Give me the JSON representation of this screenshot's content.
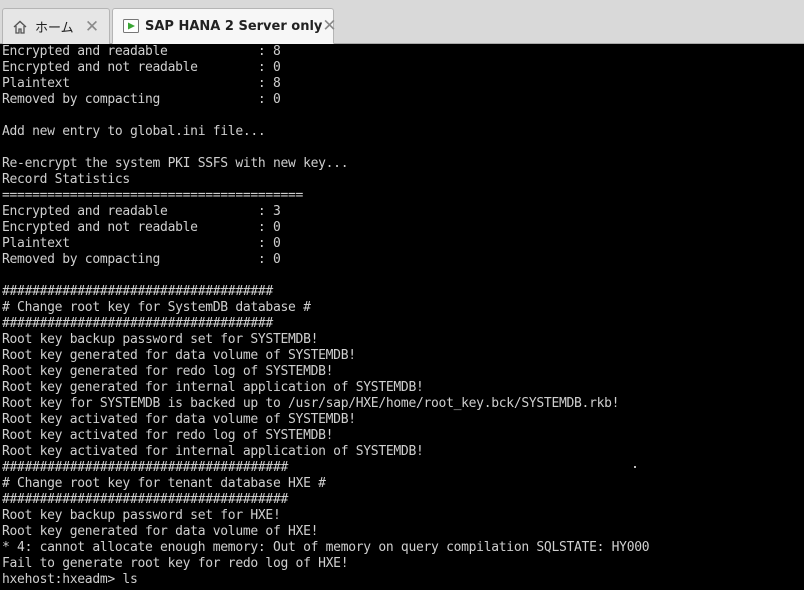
{
  "tabs": [
    {
      "label": "ホーム",
      "icon": "home-icon",
      "active": false
    },
    {
      "label": "SAP HANA 2 Server only",
      "icon": "vm-play-icon",
      "active": true
    }
  ],
  "colors": {
    "terminal_bg": "#000000",
    "terminal_fg": "#cfcfcf",
    "tabbar_bg": "#d9d9d9",
    "vm_icon_green": "#3aa635"
  },
  "terminal": {
    "lines": [
      "Encrypted and readable            : 8",
      "Encrypted and not readable        : 0",
      "Plaintext                         : 8",
      "Removed by compacting             : 0",
      "",
      "Add new entry to global.ini file...",
      "",
      "Re-encrypt the system PKI SSFS with new key...",
      "Record Statistics",
      "========================================",
      "Encrypted and readable            : 3",
      "Encrypted and not readable        : 0",
      "Plaintext                         : 0",
      "Removed by compacting             : 0",
      "",
      "####################################",
      "# Change root key for SystemDB database #",
      "####################################",
      "Root key backup password set for SYSTEMDB!",
      "Root key generated for data volume of SYSTEMDB!",
      "Root key generated for redo log of SYSTEMDB!",
      "Root key generated for internal application of SYSTEMDB!",
      "Root key for SYSTEMDB is backed up to /usr/sap/HXE/home/root_key.bck/SYSTEMDB.rkb!",
      "Root key activated for data volume of SYSTEMDB!",
      "Root key activated for redo log of SYSTEMDB!",
      "Root key activated for internal application of SYSTEMDB!",
      "######################################",
      "# Change root key for tenant database HXE #",
      "######################################",
      "Root key backup password set for HXE!",
      "Root key generated for data volume of HXE!",
      "* 4: cannot allocate enough memory: Out of memory on query compilation SQLSTATE: HY000",
      "Fail to generate root key for redo log of HXE!",
      "hxehost:hxeadm> ls"
    ]
  }
}
